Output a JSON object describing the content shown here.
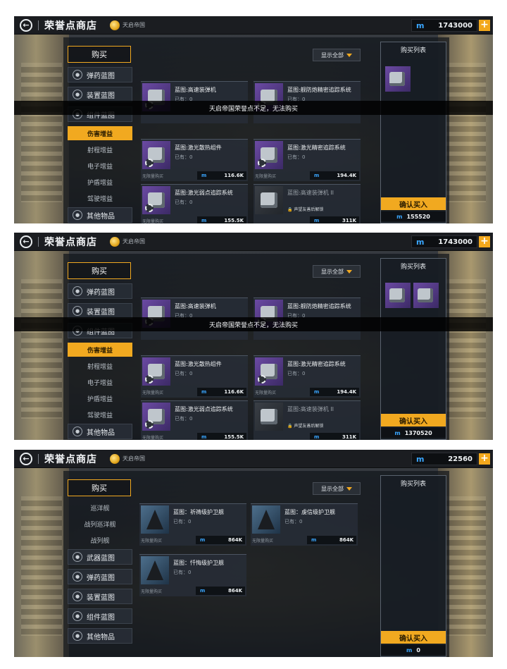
{
  "common": {
    "title": "荣誉点商店",
    "faction": "天启帝国",
    "buy_tab": "购买",
    "filter": "显示全部",
    "cart_title": "购买列表",
    "confirm": "确认买入",
    "currency_icon": "m",
    "plus": "+",
    "back": "←"
  },
  "screens": [
    {
      "balance": "1743000",
      "banner": "天启帝国荣誉点不足，无法购买",
      "side": {
        "cats_top": [
          "弹药蓝图",
          "装置蓝图",
          "组件蓝图"
        ],
        "subs": [
          "伤害增益",
          "射程增益",
          "电子增益",
          "护盾增益",
          "驾驶增益"
        ],
        "active_sub": "伤害增益",
        "cat_bottom": "其他物品"
      },
      "cards": [
        {
          "name": "蓝图:高速装弹机",
          "owned": "已有：0",
          "limit": "",
          "price": ""
        },
        {
          "name": "蓝图:舰防炮精密追踪系统",
          "owned": "已有：0",
          "limit": "",
          "price": ""
        },
        {
          "name": "蓝图:激光散热组件",
          "owned": "已有：0",
          "limit": "无限量购买",
          "price": "116.6K"
        },
        {
          "name": "蓝图:激光精密追踪系统",
          "owned": "已有：0",
          "limit": "无限量购买",
          "price": "194.4K"
        },
        {
          "name": "蓝图:激光弱点追踪系统",
          "owned": "已有：0",
          "limit": "无限量购买",
          "price": "155.5K"
        },
        {
          "name": "蓝图:高速装弹机 II",
          "owned": "",
          "limit": "",
          "price": "311K",
          "lock": "声望友善后解锁"
        }
      ],
      "cart_total": "155520"
    },
    {
      "balance": "1743000",
      "banner": "天启帝国荣誉点不足，无法购买",
      "side": {
        "cats_top": [
          "弹药蓝图",
          "装置蓝图",
          "组件蓝图"
        ],
        "subs": [
          "伤害增益",
          "射程增益",
          "电子增益",
          "护盾增益",
          "驾驶增益"
        ],
        "active_sub": "伤害增益",
        "cat_bottom": "其他物品"
      },
      "cards": [
        {
          "name": "蓝图:高速装弹机",
          "owned": "已有：0",
          "limit": "",
          "price": ""
        },
        {
          "name": "蓝图:舰防炮精密追踪系统",
          "owned": "已有：0",
          "limit": "",
          "price": ""
        },
        {
          "name": "蓝图:激光散热组件",
          "owned": "已有：0",
          "limit": "无限量购买",
          "price": "116.6K"
        },
        {
          "name": "蓝图:激光精密追踪系统",
          "owned": "已有：0",
          "limit": "无限量购买",
          "price": "194.4K"
        },
        {
          "name": "蓝图:激光弱点追踪系统",
          "owned": "已有：0",
          "limit": "无限量购买",
          "price": "155.5K"
        },
        {
          "name": "蓝图:高速装弹机 II",
          "owned": "",
          "limit": "",
          "price": "311K",
          "lock": "声望友善后解锁"
        }
      ],
      "cart_total": "1370520"
    },
    {
      "balance": "22560",
      "banner": "",
      "side": {
        "subs": [
          "巡洋舰",
          "战列巡洋舰",
          "战列舰"
        ],
        "cats": [
          "武器蓝图",
          "弹药蓝图",
          "装置蓝图",
          "组件蓝图",
          "其他物品"
        ]
      },
      "cards": [
        {
          "name": "蓝图：祈祷级护卫舰",
          "owned": "已有：0",
          "limit": "无限量购买",
          "price": "864K"
        },
        {
          "name": "蓝图：虔信级护卫舰",
          "owned": "已有：0",
          "limit": "无限量购买",
          "price": "864K"
        },
        {
          "name": "蓝图：忏悔级护卫舰",
          "owned": "已有：0",
          "limit": "无限量购买",
          "price": "864K"
        }
      ],
      "cart_total": "0"
    }
  ]
}
